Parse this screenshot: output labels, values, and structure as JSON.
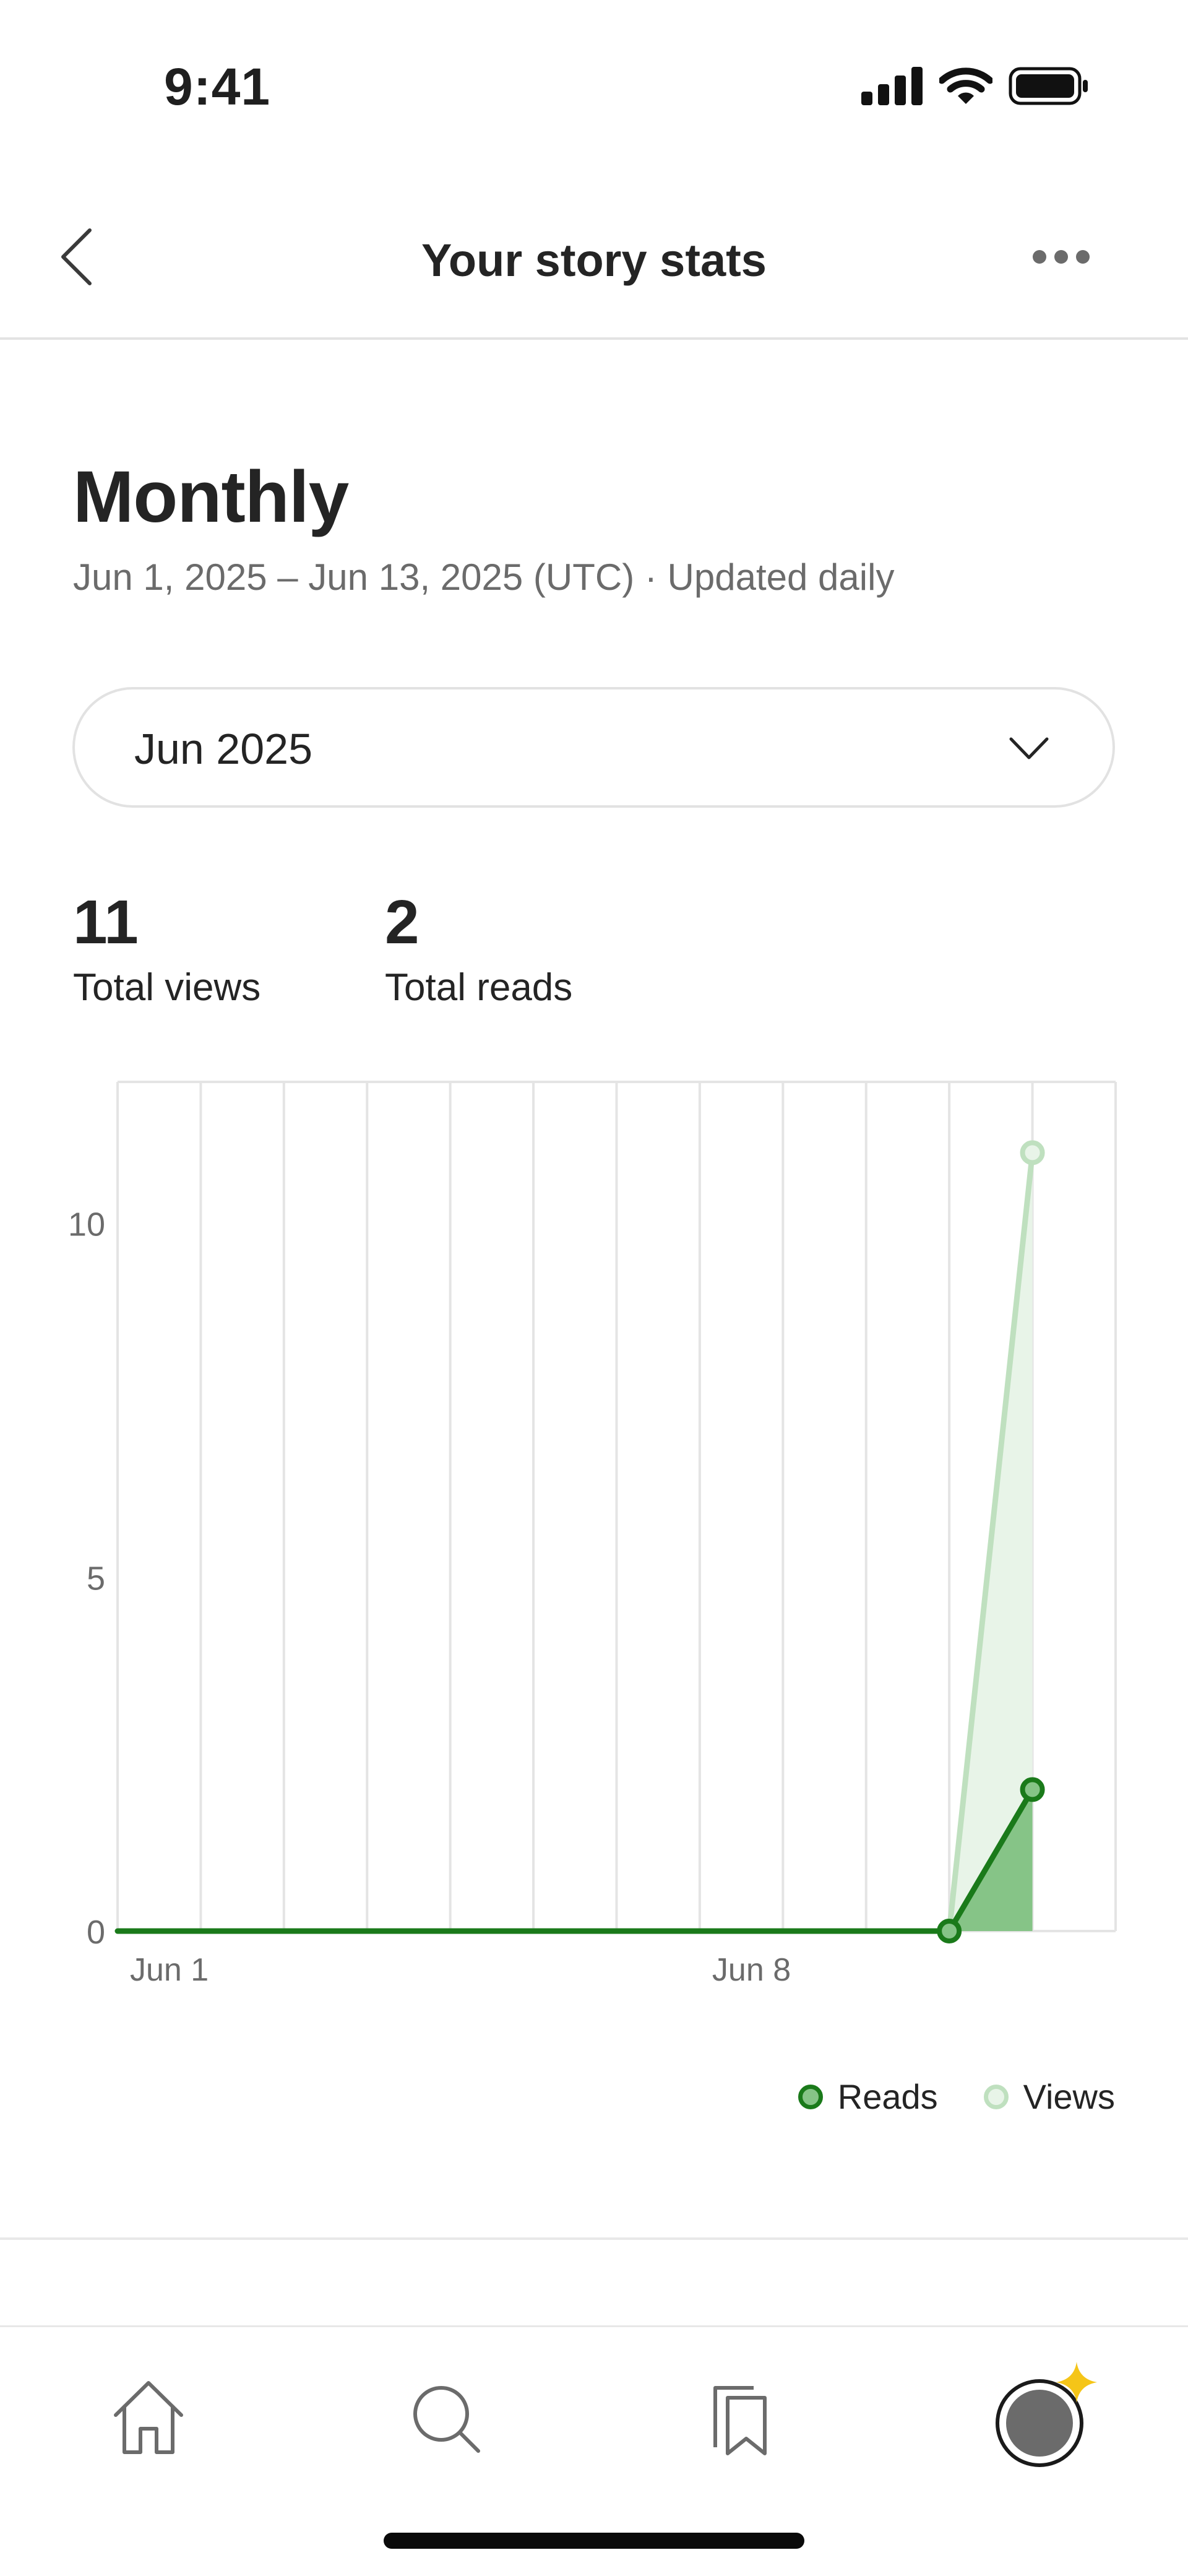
{
  "status_bar": {
    "time": "9:41"
  },
  "header": {
    "title": "Your story stats"
  },
  "section": {
    "title": "Monthly",
    "subtitle": "Jun 1, 2025 – Jun 13, 2025 (UTC) · Updated daily"
  },
  "month_selector": {
    "selected": "Jun 2025"
  },
  "stats": [
    {
      "value": "11",
      "label": "Total views"
    },
    {
      "value": "2",
      "label": "Total reads"
    }
  ],
  "chart_data": {
    "type": "line",
    "x": [
      "Jun 1",
      "Jun 2",
      "Jun 3",
      "Jun 4",
      "Jun 5",
      "Jun 6",
      "Jun 7",
      "Jun 8",
      "Jun 9",
      "Jun 10",
      "Jun 11",
      "Jun 12"
    ],
    "x_tick_labels": [
      {
        "index": 0,
        "label": "Jun 1"
      },
      {
        "index": 7,
        "label": "Jun 8"
      }
    ],
    "y_ticks": [
      0,
      5,
      10
    ],
    "ylim": [
      0,
      12
    ],
    "grid": "vertical",
    "legend_position": "bottom-right",
    "series": [
      {
        "name": "Reads",
        "values": [
          0,
          0,
          0,
          0,
          0,
          0,
          0,
          0,
          0,
          0,
          0,
          2
        ],
        "color": "#1a7a1a",
        "fill": "#86c487",
        "markers_from_index": 10
      },
      {
        "name": "Views",
        "values": [
          0,
          0,
          0,
          0,
          0,
          0,
          0,
          0,
          0,
          0,
          0,
          11
        ],
        "color": "#bfe0bf",
        "fill": "#e8f4e8",
        "markers_from_index": 11
      }
    ]
  },
  "tab_bar": {
    "tabs": [
      {
        "name": "home",
        "icon": "home-icon"
      },
      {
        "name": "search",
        "icon": "search-icon"
      },
      {
        "name": "library",
        "icon": "bookmarks-icon"
      },
      {
        "name": "profile",
        "icon": "avatar-icon"
      }
    ]
  },
  "colors": {
    "reads": "#1a7a1a",
    "views": "#bfe0bf",
    "accent_star": "#f5c518"
  }
}
